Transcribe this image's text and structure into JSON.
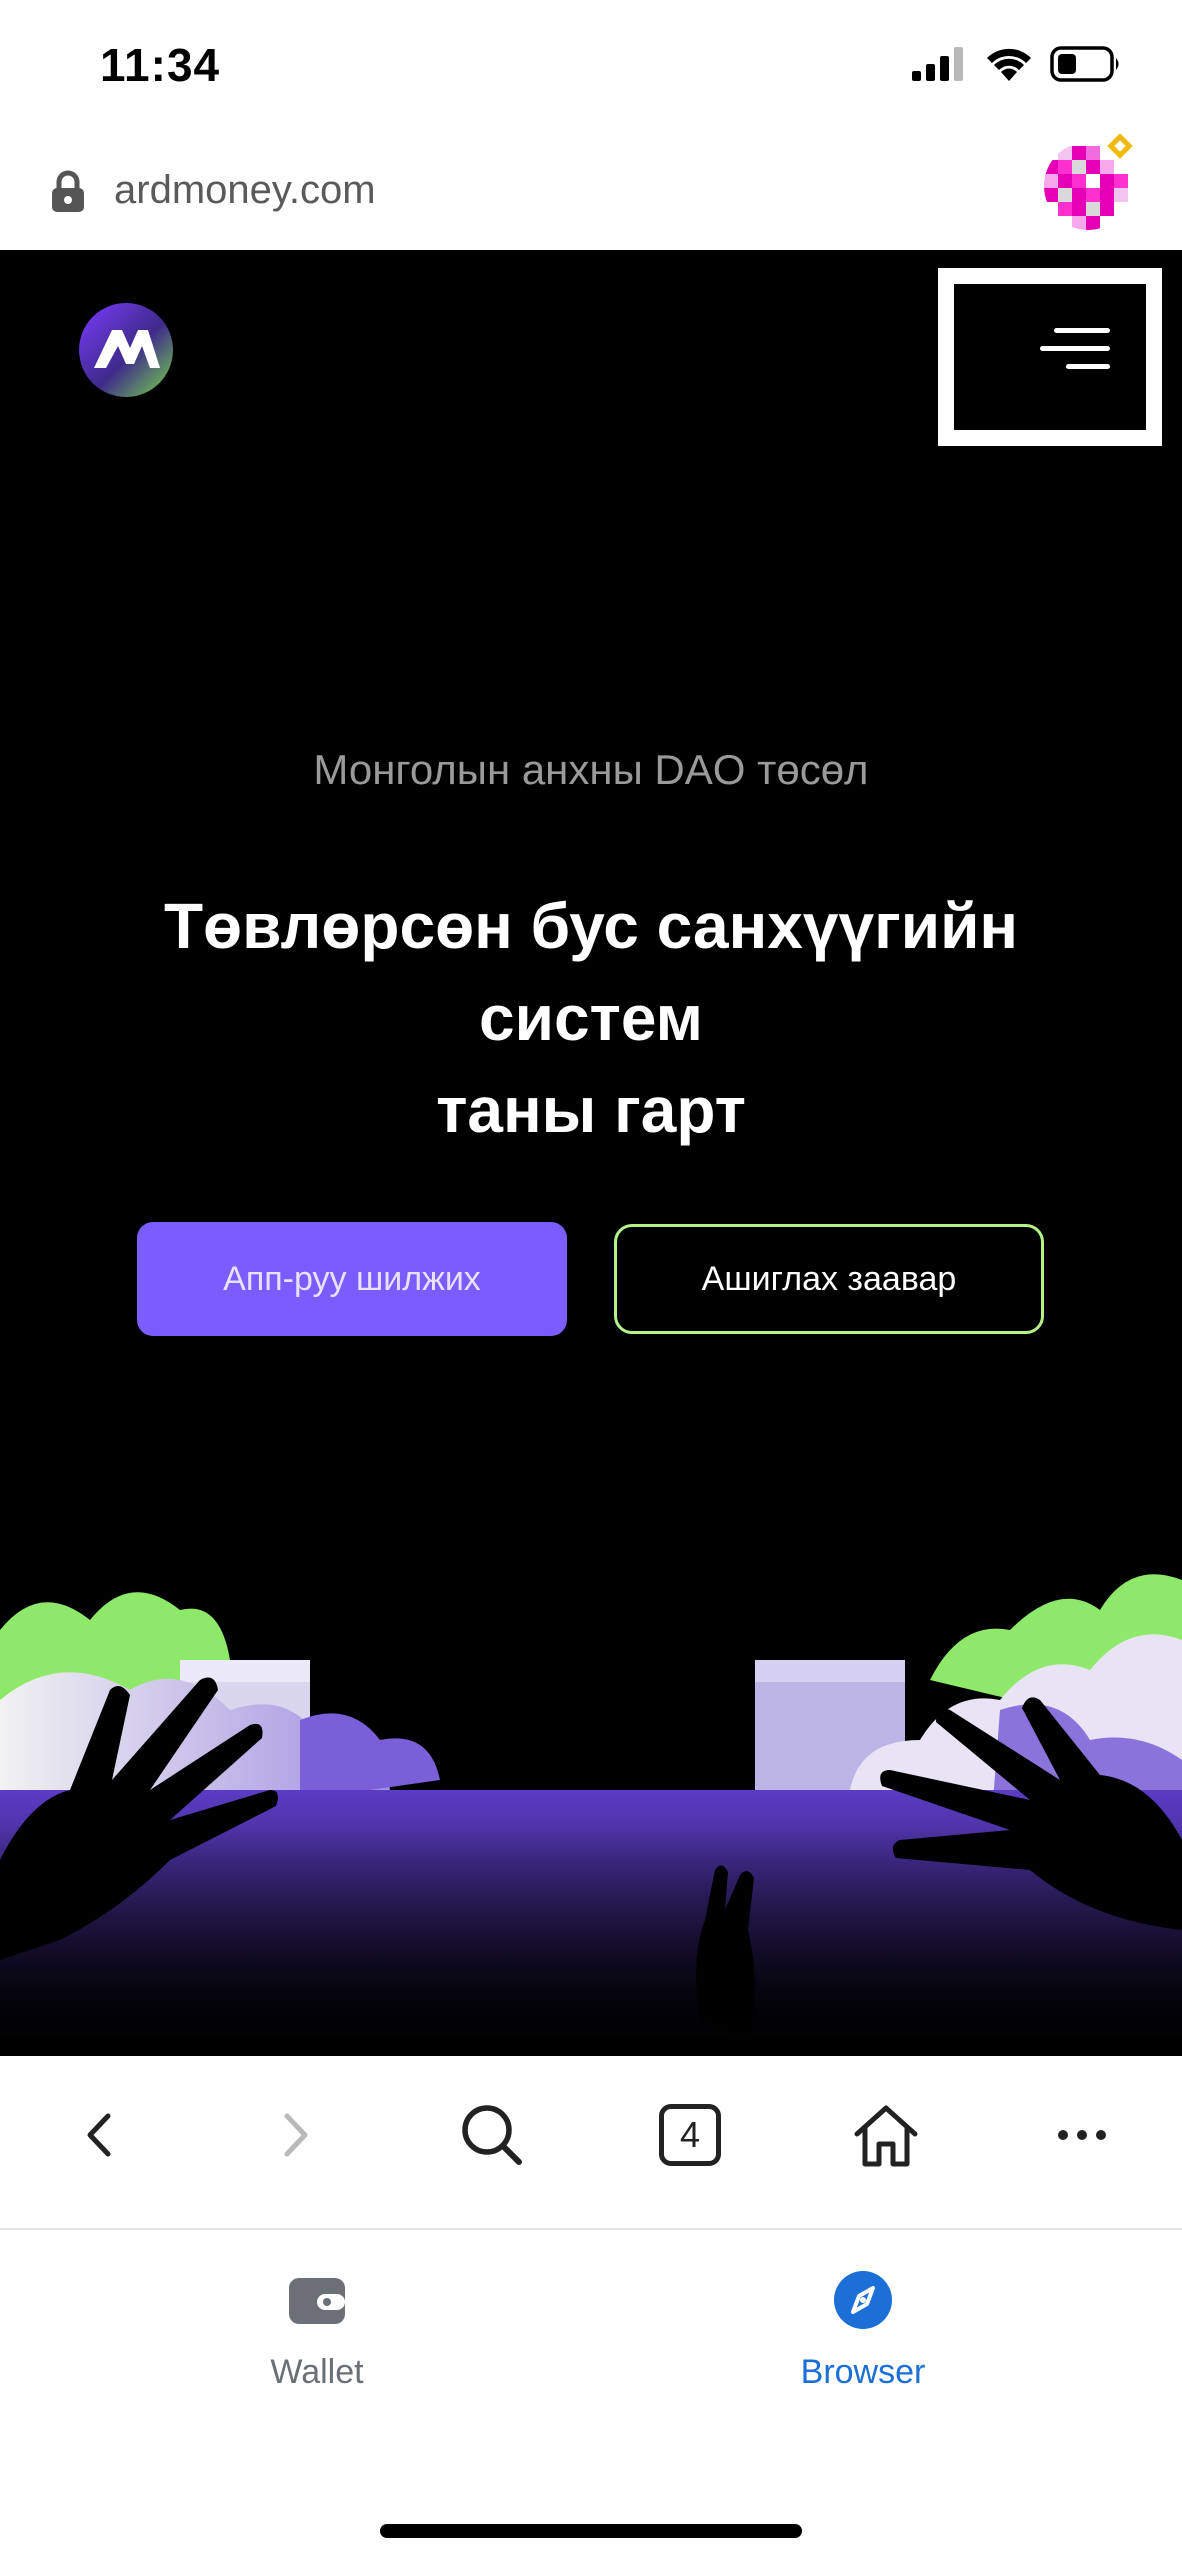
{
  "status_bar": {
    "time": "11:34"
  },
  "browser": {
    "url": "ardmoney.com",
    "tab_count": "4"
  },
  "site": {
    "subtitle": "Монголын анхны DAO төсөл",
    "headline_lines": [
      "Төвлөрсөн бус санхүүгийн",
      "систем",
      "таны гарт"
    ],
    "primary_button": "Апп-руу шилжих",
    "secondary_button": "Ашиглах заавар"
  },
  "tabs": {
    "wallet": {
      "label": "Wallet",
      "active": false
    },
    "browser": {
      "label": "Browser",
      "active": true
    }
  },
  "colors": {
    "accent_purple": "#7b5cff",
    "accent_green": "#b4f28a",
    "tab_active": "#1b6fd6",
    "tab_inactive": "#6a6f78"
  }
}
